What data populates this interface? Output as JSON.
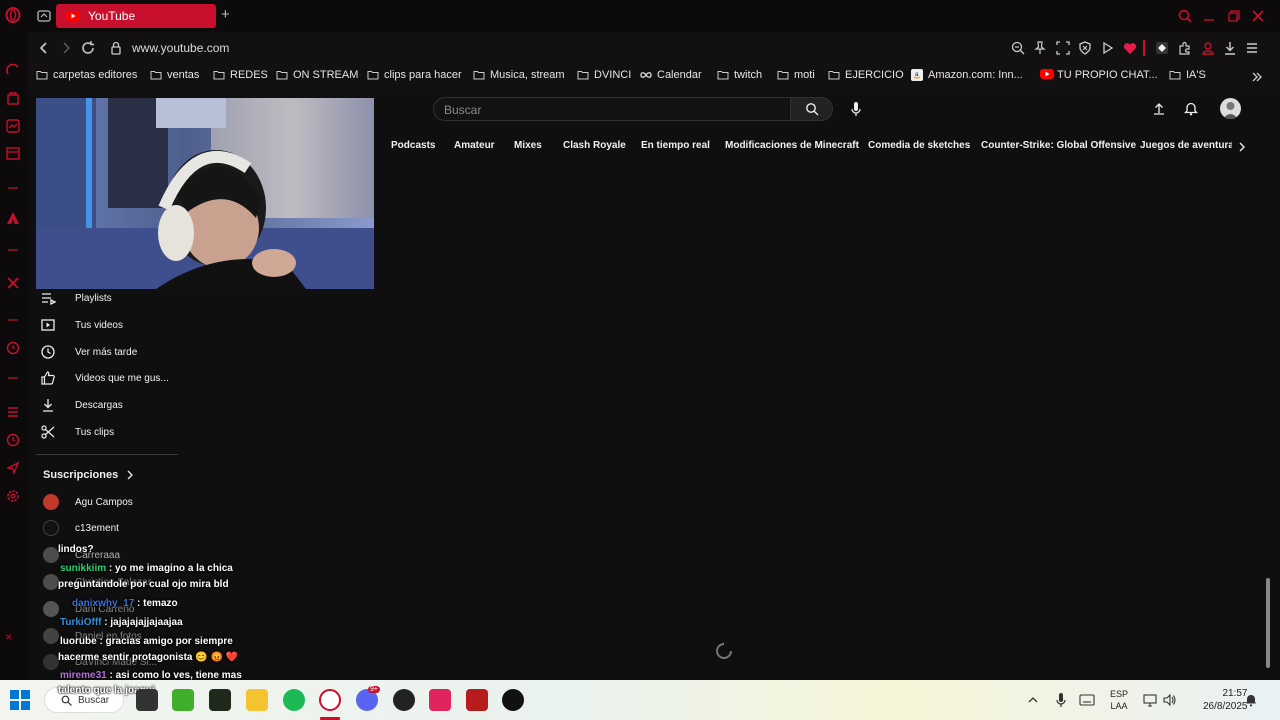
{
  "tab": {
    "title": "YouTube",
    "new_tab": "+"
  },
  "address": {
    "url": "www.youtube.com"
  },
  "bookmarks": [
    {
      "label": "carpetas editores",
      "icon": "folder-icon"
    },
    {
      "label": "ventas",
      "icon": "folder-icon"
    },
    {
      "label": "REDES",
      "icon": "folder-icon"
    },
    {
      "label": "ON STREAM",
      "icon": "folder-icon"
    },
    {
      "label": "clips para hacer",
      "icon": "folder-icon"
    },
    {
      "label": "Musica, stream",
      "icon": "folder-icon"
    },
    {
      "label": "DVINCI",
      "icon": "folder-icon"
    },
    {
      "label": "Calendar",
      "icon": "infinity-icon"
    },
    {
      "label": "twitch",
      "icon": "folder-icon"
    },
    {
      "label": "moti",
      "icon": "folder-icon"
    },
    {
      "label": "EJERCICIO",
      "icon": "folder-icon"
    },
    {
      "label": "Amazon.com: Inn...",
      "icon": "amazon-icon"
    },
    {
      "label": "TU PROPIO CHAT...",
      "icon": "youtube-icon"
    },
    {
      "label": "IA'S",
      "icon": "folder-icon"
    }
  ],
  "search": {
    "placeholder": "Buscar"
  },
  "chips": [
    "Podcasts",
    "Amateur",
    "Mixes",
    "Clash Royale",
    "En tiempo real",
    "Modificaciones de Minecraft",
    "Comedia de sketches",
    "Counter-Strike: Global Offensive",
    "Juegos de aventura y a"
  ],
  "guide": {
    "items": [
      {
        "label": "Playlists",
        "icon": "playlist-icon"
      },
      {
        "label": "Tus videos",
        "icon": "video-icon"
      },
      {
        "label": "Ver más tarde",
        "icon": "clock-icon"
      },
      {
        "label": "Videos que me gus...",
        "icon": "thumbs-up-icon"
      },
      {
        "label": "Descargas",
        "icon": "download-icon"
      },
      {
        "label": "Tus clips",
        "icon": "scissors-icon"
      }
    ],
    "subscriptions_title": "Suscripciones",
    "subscriptions": [
      "Agu Campos",
      "c13ement",
      "Carreraaa",
      "Christian Salazar",
      "Dani Carreño",
      "Daniel en fotos",
      "DaVinci Made Si..."
    ]
  },
  "chat": [
    {
      "user": "",
      "text": "lindos?",
      "color": "#ffffff"
    },
    {
      "user": "sunikkiim",
      "text": ": yo me imagino a la chica",
      "color": "#2ecc71"
    },
    {
      "user": "",
      "text": "preguntandole por cual ojo mira bld",
      "color": "#ffffff"
    },
    {
      "user": "danixwhy_17",
      "text": ": temazo",
      "color": "#3a6fd8"
    },
    {
      "user": "TurkiOfff",
      "text": ": jajajajajjajaajaa",
      "color": "#3a8fd8"
    },
    {
      "user": "luorube",
      "text": ": gracias amigo por siempre",
      "color": "#ffffff"
    },
    {
      "user": "",
      "text": "hacerme sentir protagonista 😊 😡 ❤️",
      "color": "#ffffff"
    },
    {
      "user": "mireme31",
      "text": ": asi como lo ves, tiene mas",
      "color": "#b06fd8"
    },
    {
      "user": "",
      "text": "talento que la joaqui",
      "color": "#ffffff"
    }
  ],
  "taskbar": {
    "search_label": "Buscar",
    "lang_1": "ESP",
    "lang_2": "LAA",
    "time": "21:57",
    "date": "26/8/2025",
    "badge": "9+"
  },
  "colors": {
    "opera_red": "#c8102e",
    "bg": "#0f0f0f",
    "yt_red": "#ff0000"
  }
}
